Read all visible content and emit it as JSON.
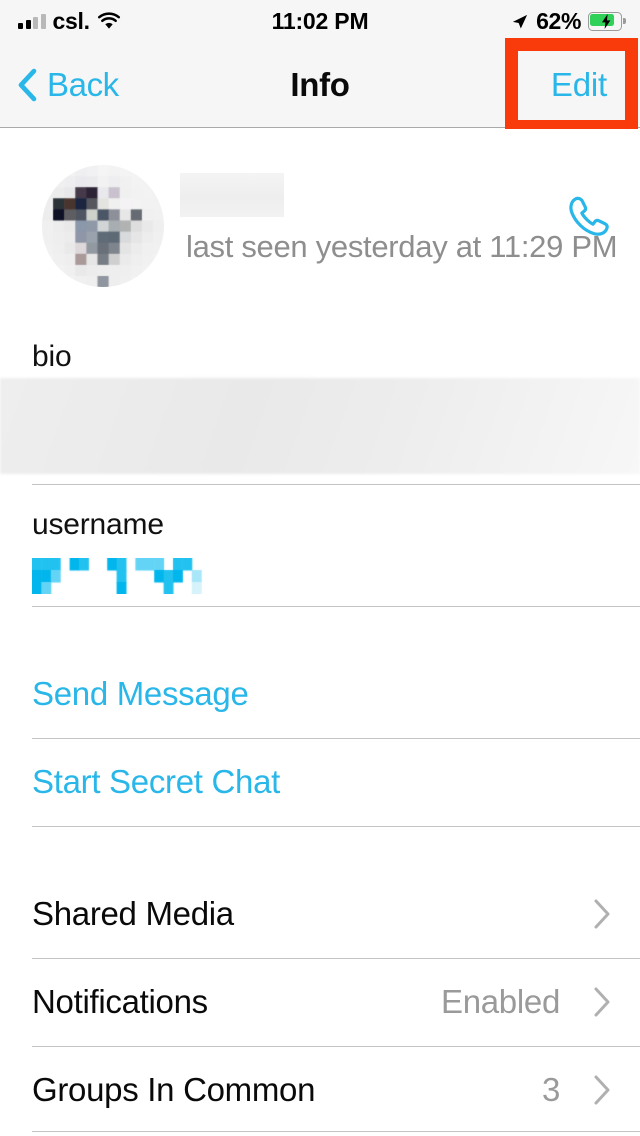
{
  "status_bar": {
    "carrier": "csl.",
    "time": "11:02 PM",
    "battery_percent": "62%",
    "battery_charging": true,
    "signal_bars_filled": 2,
    "signal_bars_total": 4,
    "wifi_icon": "wifi-icon",
    "location_icon": "location-arrow-icon",
    "battery_icon": "battery-charging-icon"
  },
  "nav_bar": {
    "back_label": "Back",
    "back_icon": "chevron-left-icon",
    "title": "Info",
    "edit_label": "Edit"
  },
  "annotation": {
    "target": "edit-button",
    "color": "#f93b0c",
    "shape": "rectangle"
  },
  "profile": {
    "avatar_icon": "avatar-pixelated",
    "name_redacted": true,
    "last_seen": "last seen yesterday at 11:29 PM",
    "call_icon": "phone-icon"
  },
  "bio_section": {
    "label": "bio",
    "value_redacted": true
  },
  "username_section": {
    "label": "username",
    "value_redacted": true
  },
  "actions": [
    {
      "label": "Send Message",
      "name": "send-message-button"
    },
    {
      "label": "Start Secret Chat",
      "name": "start-secret-chat-button"
    }
  ],
  "settings": [
    {
      "title": "Shared Media",
      "value": "",
      "chevron": "chevron-right-icon"
    },
    {
      "title": "Notifications",
      "value": "Enabled",
      "chevron": "chevron-right-icon"
    },
    {
      "title": "Groups In Common",
      "value": "3",
      "chevron": "chevron-right-icon"
    }
  ],
  "colors": {
    "accent": "#29b6e8",
    "annotation": "#f93b0c",
    "battery_green": "#2fd158",
    "separator": "#c4c4c4",
    "secondary_text": "#9a9a9a",
    "chrome_bg": "#f6f6f6"
  }
}
